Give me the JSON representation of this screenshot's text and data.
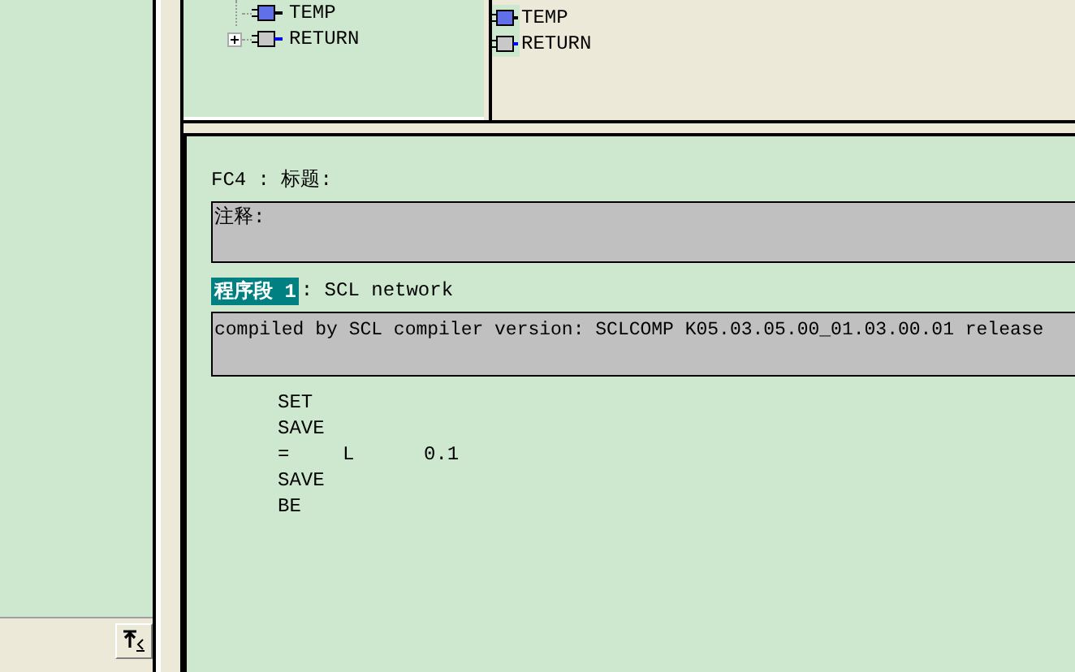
{
  "tree": [
    {
      "label": "TEMP",
      "kind": "temp"
    },
    {
      "label": "RETURN",
      "kind": "return",
      "expanded": false
    }
  ],
  "list": [
    {
      "label": "TEMP",
      "kind": "temp"
    },
    {
      "label": "RETURN",
      "kind": "return"
    }
  ],
  "block": {
    "title": "FC4 : 标题:",
    "comment": "注释:"
  },
  "network": {
    "label": "程序段 1",
    "title": ": SCL network",
    "comment": "compiled by SCL compiler version:  SCLCOMP K05.03.05.00_01.03.00.01 release"
  },
  "code": [
    {
      "op": "SET"
    },
    {
      "op": "SAVE"
    },
    {
      "op": "=",
      "operand": "L",
      "address": "0.1"
    },
    {
      "op": "SAVE"
    },
    {
      "op": "BE"
    }
  ]
}
